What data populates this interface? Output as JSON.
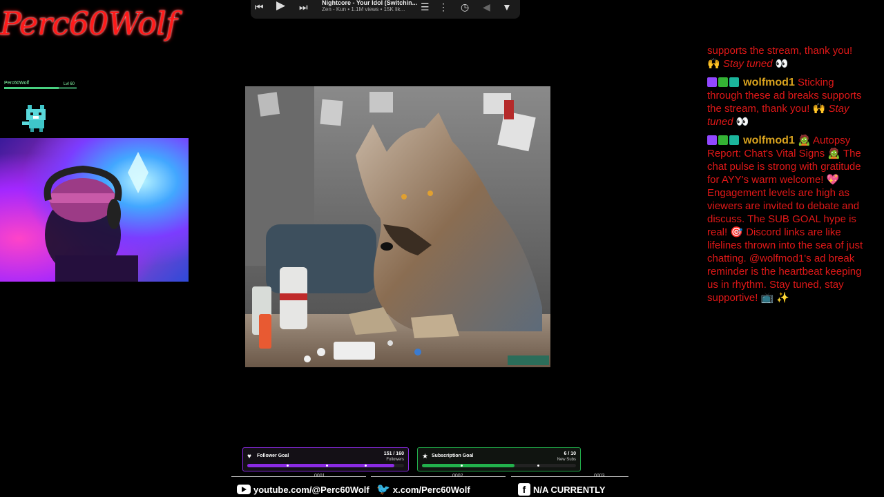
{
  "overlay": {
    "logo_text": "Perc60Wolf",
    "mini_user": "Perc60Wolf",
    "mini_level": "Lvl 60"
  },
  "player": {
    "title": "Nightcore - Your Idol (Switchin...",
    "meta": "Zen - Kun • 1.1M views • 15K lik..."
  },
  "chat": {
    "messages": [
      {
        "user": "",
        "text": "supports the stream, thank you!",
        "emoji1": "🙌",
        "ital": "Stay tuned",
        "emoji2": "👀"
      },
      {
        "user": "wolfmod1",
        "text": "Sticking through these ad breaks supports the stream, thank you!",
        "emoji1": "🙌",
        "ital": "Stay tuned",
        "emoji2": "👀"
      },
      {
        "user": "wolfmod1",
        "text": "🧟 Autopsy Report: Chat's Vital Signs 🧟 The chat pulse is strong with gratitude for AYY's warm welcome! 💖 Engagement levels are high as viewers are invited to debate and discuss. The SUB GOAL hype is real! 🎯 Discord links are like lifelines thrown into the sea of just chatting. @wolfmod1's ad break reminder is the heartbeat keeping us in rhythm. Stay tuned, stay supportive! 📺 ✨"
      }
    ]
  },
  "goals": {
    "follower": {
      "label": "Follower Goal",
      "count": "151 / 160",
      "unit": "Followers",
      "progress": 0.94,
      "color": "#8a2be2"
    },
    "sub": {
      "label": "Subscription Goal",
      "count": "6 / 10",
      "unit": "New Subs",
      "progress": 0.6,
      "color": "#22b14c"
    }
  },
  "socials": {
    "youtube": "youtube.com/@Perc60Wolf",
    "x": "x.com/Perc60Wolf",
    "facebook": "N/A CURRENTLY",
    "n1": "0001",
    "n2": "0002",
    "n3": "0003"
  },
  "colors": {
    "chat_text": "#e01818",
    "chat_user": "#d8a21e",
    "logo": "#ff1a1a"
  }
}
